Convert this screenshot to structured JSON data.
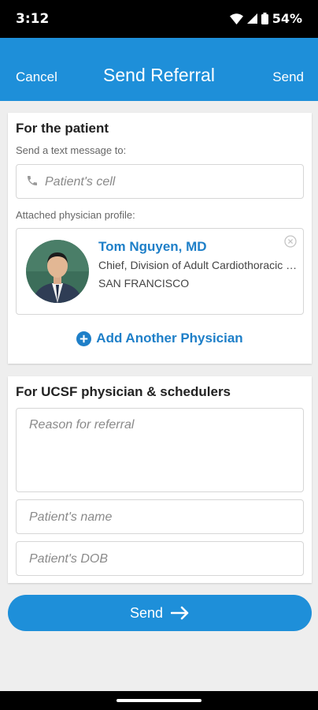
{
  "status_bar": {
    "time": "3:12",
    "battery": "54%"
  },
  "appbar": {
    "cancel_label": "Cancel",
    "title": "Send Referral",
    "send_label": "Send"
  },
  "patient_section": {
    "heading": "For the patient",
    "text_label": "Send a text message to:",
    "cell_placeholder": "Patient's cell",
    "profile_label": "Attached physician profile:",
    "physician": {
      "name": "Tom Nguyen, MD",
      "title": "Chief, Division of Adult Cardiothoracic Surgery",
      "location": "SAN FRANCISCO"
    },
    "add_physician_label": "Add Another Physician"
  },
  "ucsf_section": {
    "heading": "For UCSF physician & schedulers",
    "reason_placeholder": "Reason for referral",
    "name_placeholder": "Patient's name",
    "dob_placeholder": "Patient's DOB"
  },
  "send_button_label": "Send",
  "icons": {
    "phone": "phone-icon",
    "remove": "close-circle-icon",
    "add": "plus-circle-icon",
    "arrow": "arrow-right-icon"
  },
  "colors": {
    "accent": "#1e8fd9",
    "link": "#1e7fc8",
    "background": "#eeeeee"
  }
}
